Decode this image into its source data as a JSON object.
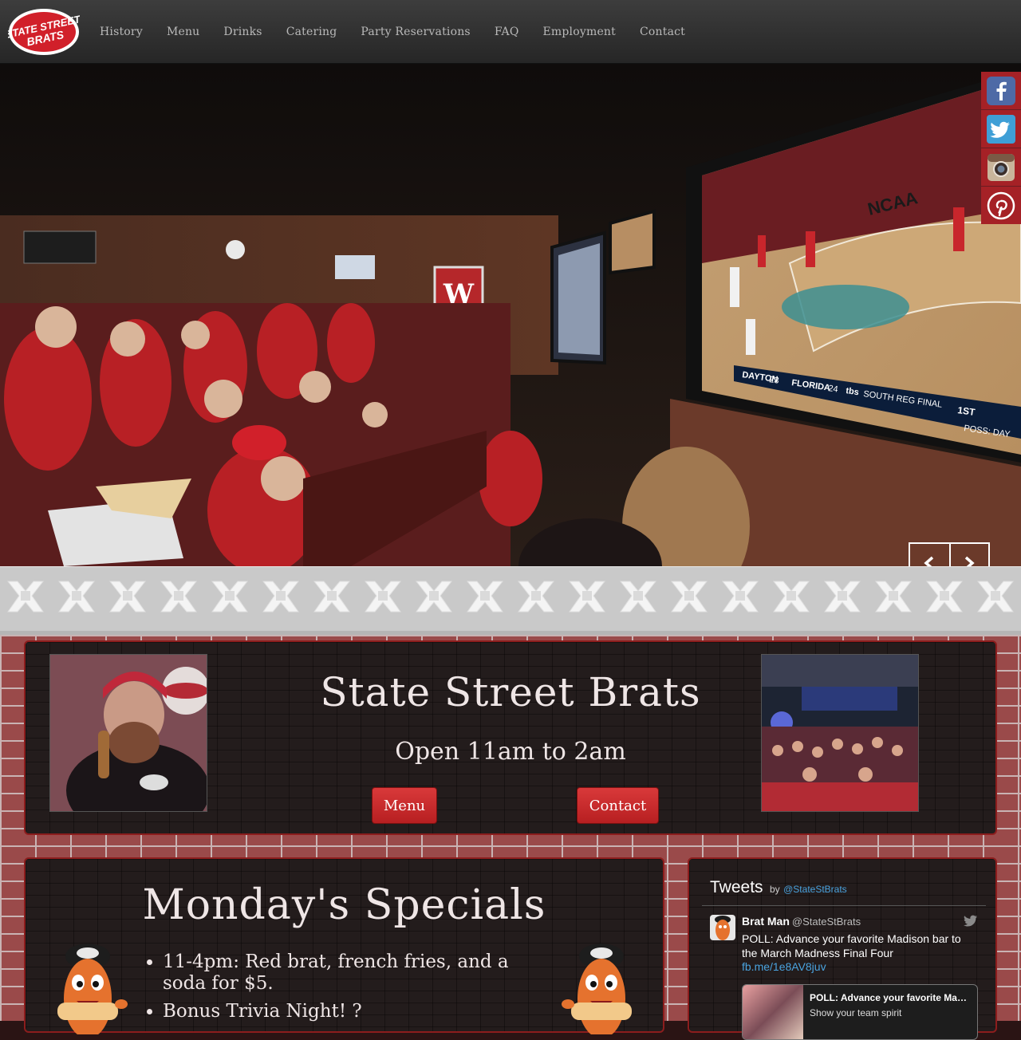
{
  "brand": {
    "logo_line1": "STATE STREET",
    "logo_line2": "BRATS",
    "logo_color": "#d1202a"
  },
  "nav": {
    "items": [
      "History",
      "Menu",
      "Drinks",
      "Catering",
      "Party Reservations",
      "FAQ",
      "Employment",
      "Contact"
    ]
  },
  "hero": {
    "screen_text": {
      "ncaa": "NCAA",
      "team1": "DAYTON",
      "score1": "23",
      "team2": "FLORIDA",
      "score2": "24",
      "network": "tbs",
      "event": "SOUTH REG FINAL",
      "period": "1ST",
      "possession": "POSS: DAY"
    },
    "slider": {
      "prev_icon": "chevron-left-icon",
      "next_icon": "chevron-right-icon"
    }
  },
  "social": [
    "facebook-icon",
    "twitter-icon",
    "instagram-icon",
    "pinterest-icon"
  ],
  "intro": {
    "title": "State Street Brats",
    "hours": "Open 11am to 2am",
    "menu_button": "Menu",
    "contact_button": "Contact"
  },
  "specials": {
    "title": "Monday's Specials",
    "items": [
      "11-4pm: Red brat, french fries, and a soda for $5.",
      "Bonus Trivia Night! ?"
    ]
  },
  "tweets": {
    "header": "Tweets",
    "by": "by",
    "handle": "@StateStBrats",
    "tweet": {
      "name": "Brat Man",
      "handle": "@StateStBrats",
      "text": "POLL: Advance your favorite Madison bar to the March Madness Final Four",
      "link": "fb.me/1e8AV8juv",
      "card_title": "POLL: Advance your favorite Madison bar to",
      "card_sub": "Show your team spirit"
    }
  },
  "colors": {
    "accent_red": "#c62a2c",
    "nav_bg": "#2f2f2f",
    "twitter_blue": "#4aa3df"
  }
}
